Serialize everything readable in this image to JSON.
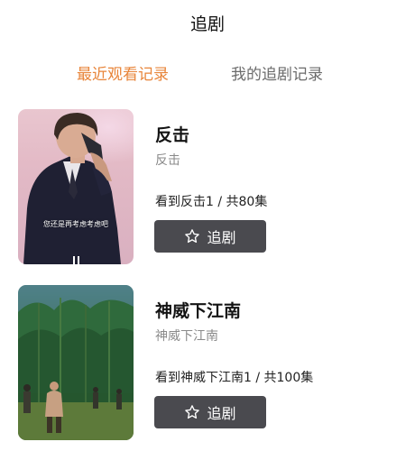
{
  "header": {
    "title": "追剧"
  },
  "tabs": [
    {
      "label": "最近观看记录",
      "active": true
    },
    {
      "label": "我的追剧记录",
      "active": false
    }
  ],
  "colors": {
    "accent": "#e8853a",
    "button_bg": "#4a4a4f",
    "muted_text": "#8a8a8a"
  },
  "shows": [
    {
      "title": "反击",
      "subtitle": "反击",
      "progress": "看到反击1 / 共80集",
      "button_label": "追剧",
      "button_icon": "star-outline-icon",
      "cover_caption": "您还是再考虑考虑吧"
    },
    {
      "title": "神威下江南",
      "subtitle": "神威下江南",
      "progress": "看到神威下江南1 / 共100集",
      "button_label": "追剧",
      "button_icon": "star-outline-icon"
    }
  ]
}
